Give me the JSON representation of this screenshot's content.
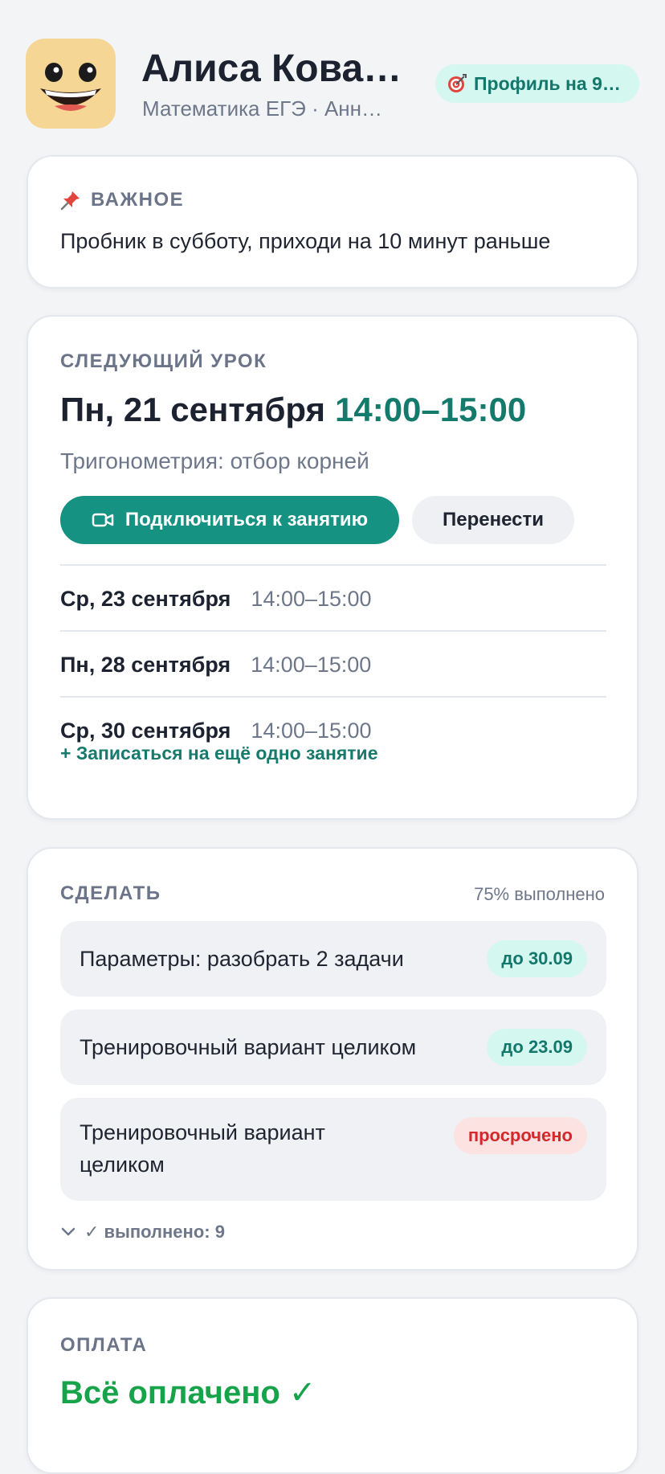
{
  "header": {
    "name": "Алиса Кова…",
    "subtitle": "Математика ЕГЭ · Анн…",
    "goal_chip": "Профиль на 9…",
    "goal_icon": "target-icon"
  },
  "important": {
    "label": "ВАЖНОЕ",
    "icon": "pin-icon",
    "text": "Пробник в субботу, приходи на 10 минут раньше"
  },
  "next_lesson": {
    "label": "СЛЕДУЮЩИЙ УРОК",
    "date": "Пн, 21 сентября",
    "time": "14:00–15:00",
    "topic": "Тригонометрия: отбор корней",
    "join_label": "Подключиться к занятию",
    "reschedule_label": "Перенести",
    "upcoming": [
      {
        "date": "Ср, 23 сентября",
        "time": "14:00–15:00"
      },
      {
        "date": "Пн, 28 сентября",
        "time": "14:00–15:00"
      },
      {
        "date": "Ср, 30 сентября",
        "time": "14:00–15:00"
      }
    ],
    "book_more": "+ Записаться на ещё одно занятие"
  },
  "todo": {
    "label": "СДЕЛАТЬ",
    "progress": "75% выполнено",
    "tasks": [
      {
        "text": "Параметры: разобрать 2 задачи",
        "badge": "до 30.09",
        "status": "due"
      },
      {
        "text": "Тренировочный вариант целиком",
        "badge": "до 23.09",
        "status": "due"
      },
      {
        "text": "Тренировочный вариант целиком",
        "badge": "просрочено",
        "status": "overdue"
      }
    ],
    "done_toggle": "✓ выполнено: 9"
  },
  "payment": {
    "label": "ОПЛАТА",
    "status": "Всё оплачено ✓"
  },
  "colors": {
    "accent": "#169283",
    "accent_text": "#147a6c",
    "chip_bg": "#d4f8ef",
    "overdue": "#d4282c",
    "paid": "#16a34a"
  }
}
